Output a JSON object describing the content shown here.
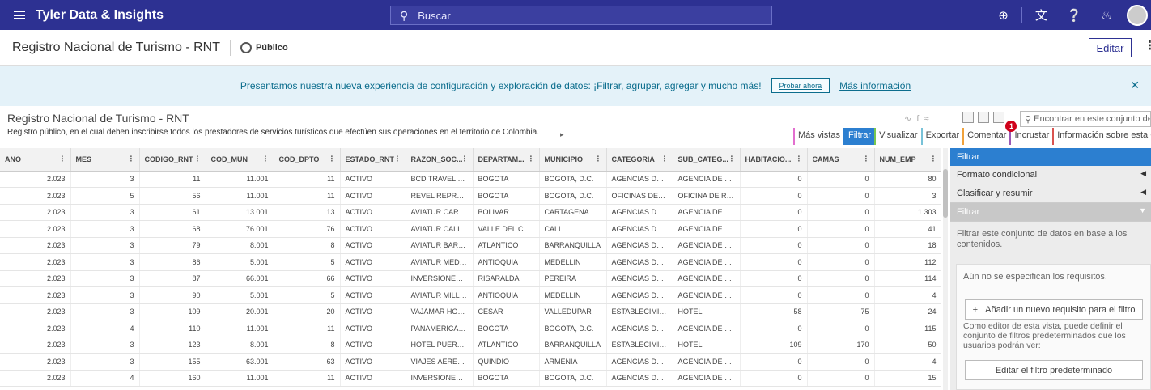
{
  "topbar": {
    "brand": "Tyler Data & Insights",
    "search_placeholder": "Buscar",
    "icons": [
      "plus-circle-icon",
      "translate-icon",
      "help-icon",
      "bell-icon"
    ]
  },
  "titlebar": {
    "title": "Registro Nacional de Turismo - RNT",
    "visibility": "Público",
    "edit_label": "Editar"
  },
  "banner": {
    "text": "Presentamos nuestra nueva experiencia de configuración y exploración de datos: ¡Filtrar, agrupar, agregar y mucho más!",
    "try_label": "Probar ahora",
    "more_label": "Más información"
  },
  "dataset": {
    "title": "Registro Nacional de Turismo - RNT",
    "description": "Registro público, en el cual deben inscribirse todos los prestadores de servicios turísticos que efectúen sus operaciones en el territorio de Colombia.",
    "find_placeholder": "Encontrar en este conjunto de"
  },
  "tabs": [
    "Más vistas",
    "Filtrar",
    "Visualizar",
    "Exportar",
    "Comentar",
    "Incrustar",
    "Información sobre esta Categoría"
  ],
  "comment_badge": "1",
  "table": {
    "columns": [
      "ANO",
      "MES",
      "CODIGO_RNT",
      "COD_MUN",
      "COD_DPTO",
      "ESTADO_RNT",
      "RAZON_SOC...",
      "DEPARTAM...",
      "MUNICIPIO",
      "CATEGORIA",
      "SUB_CATEG...",
      "HABITACIO...",
      "CAMAS",
      "NUM_EMP"
    ],
    "rows": [
      [
        "2.023",
        "3",
        "11",
        "11.001",
        "11",
        "ACTIVO",
        "BCD TRAVEL OFI...",
        "BOGOTA",
        "BOGOTA, D.C.",
        "AGENCIAS DE VI...",
        "AGENCIA DE VIA...",
        "0",
        "0",
        "80"
      ],
      [
        "2.023",
        "5",
        "56",
        "11.001",
        "11",
        "ACTIVO",
        "REVEL REPRESE...",
        "BOGOTA",
        "BOGOTA, D.C.",
        "OFICINAS DE RE...",
        "OFICINA DE REP...",
        "0",
        "0",
        "3"
      ],
      [
        "2.023",
        "3",
        "61",
        "13.001",
        "13",
        "ACTIVO",
        "AVIATUR CARTA...",
        "BOLIVAR",
        "CARTAGENA",
        "AGENCIAS DE VI...",
        "AGENCIA DE VIA...",
        "0",
        "0",
        "1.303"
      ],
      [
        "2.023",
        "3",
        "68",
        "76.001",
        "76",
        "ACTIVO",
        "AVIATUR CALI L...",
        "VALLE DEL CAUCA",
        "CALI",
        "AGENCIAS DE VI...",
        "AGENCIA DE VIA...",
        "0",
        "0",
        "41"
      ],
      [
        "2.023",
        "3",
        "79",
        "8.001",
        "8",
        "ACTIVO",
        "AVIATUR BARRA...",
        "ATLANTICO",
        "BARRANQUILLA",
        "AGENCIAS DE VI...",
        "AGENCIA DE VIA...",
        "0",
        "0",
        "18"
      ],
      [
        "2.023",
        "3",
        "86",
        "5.001",
        "5",
        "ACTIVO",
        "AVIATUR MEDEL...",
        "ANTIOQUIA",
        "MEDELLIN",
        "AGENCIAS DE VI...",
        "AGENCIA DE VIA...",
        "0",
        "0",
        "112"
      ],
      [
        "2.023",
        "3",
        "87",
        "66.001",
        "66",
        "ACTIVO",
        "INVERSIONES AE...",
        "RISARALDA",
        "PEREIRA",
        "AGENCIAS DE VI...",
        "AGENCIA DE VIA...",
        "0",
        "0",
        "114"
      ],
      [
        "2.023",
        "3",
        "90",
        "5.001",
        "5",
        "ACTIVO",
        "AVIATUR MILLA ...",
        "ANTIOQUIA",
        "MEDELLIN",
        "AGENCIAS DE VI...",
        "AGENCIA DE VIA...",
        "0",
        "0",
        "4"
      ],
      [
        "2.023",
        "3",
        "109",
        "20.001",
        "20",
        "ACTIVO",
        "VAJAMAR HOTEL",
        "CESAR",
        "VALLEDUPAR",
        "ESTABLECIMIEN...",
        "HOTEL",
        "58",
        "75",
        "24"
      ],
      [
        "2.023",
        "4",
        "110",
        "11.001",
        "11",
        "ACTIVO",
        "PANAMERICANA...",
        "BOGOTA",
        "BOGOTA, D.C.",
        "AGENCIAS DE VI...",
        "AGENCIA DE VIA...",
        "0",
        "0",
        "115"
      ],
      [
        "2.023",
        "3",
        "123",
        "8.001",
        "8",
        "ACTIVO",
        "HOTEL PUERTA ...",
        "ATLANTICO",
        "BARRANQUILLA",
        "ESTABLECIMIEN...",
        "HOTEL",
        "109",
        "170",
        "50"
      ],
      [
        "2.023",
        "3",
        "155",
        "63.001",
        "63",
        "ACTIVO",
        "VIAJES AEREOS ...",
        "QUINDIO",
        "ARMENIA",
        "AGENCIAS DE VI...",
        "AGENCIA DE VIA...",
        "0",
        "0",
        "4"
      ],
      [
        "2.023",
        "4",
        "160",
        "11.001",
        "11",
        "ACTIVO",
        "INVERSIONES C...",
        "BOGOTA",
        "BOGOTA, D.C.",
        "AGENCIAS DE VI...",
        "AGENCIA DE VIA...",
        "0",
        "0",
        "15"
      ]
    ]
  },
  "panel": {
    "header": "Filtrar",
    "sections": [
      "Formato condicional",
      "Clasificar y resumir",
      "Filtrar"
    ],
    "description": "Filtrar este conjunto de datos en base a los contenidos.",
    "no_requirements": "Aún no se especifican los requisitos.",
    "add_label": "Añadir un nuevo requisito para el filtro",
    "note": "Como editor de esta vista, puede definir el conjunto de filtros predeterminados que los usuarios podrán ver:",
    "edit_default_label": "Editar el filtro predeterminado"
  }
}
